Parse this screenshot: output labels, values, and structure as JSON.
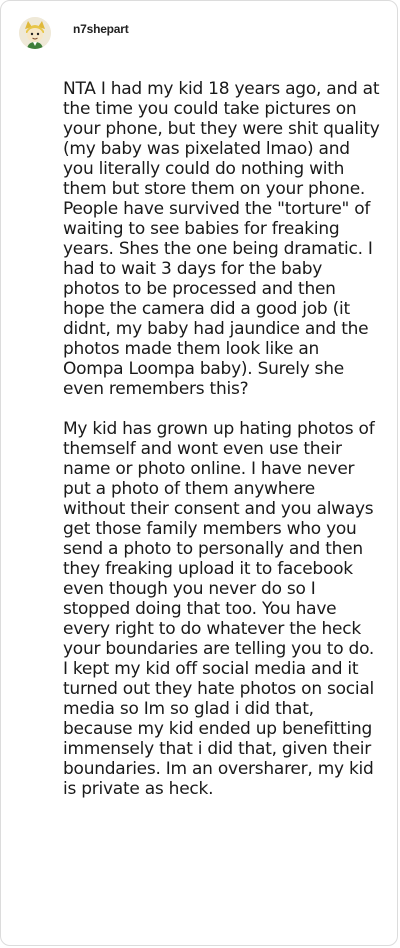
{
  "post": {
    "username": "n7shepart",
    "avatar_icon": "cartoon-character-avatar-icon",
    "paragraphs": [
      "NTA I had my kid 18 years ago, and at the time you could take pictures on your phone, but they were shit quality (my baby was pixelated lmao) and you literally could do nothing with them but store them on your phone. People have survived the \"torture\" of waiting to see babies for freaking years. Shes the one being dramatic. I had to wait 3 days for the baby photos to be processed and then hope the camera did a good job (it didnt, my baby had jaundice and the photos made them look like an Oompa Loompa baby). Surely she even remembers this?",
      "My kid has grown up hating photos of themself and wont even use their name or photo online. I have never put a photo of them anywhere without their consent and you always get those family members who you send a photo to personally and then they freaking upload it to facebook even though you never do so I stopped doing that too. You have every right to do whatever the heck your boundaries are telling you to do. I kept my kid off social media and it turned out they hate photos on social media so Im so glad i did that, because my kid ended up benefitting immensely that i did that, given their boundaries. Im an oversharer, my kid is private as heck."
    ]
  }
}
